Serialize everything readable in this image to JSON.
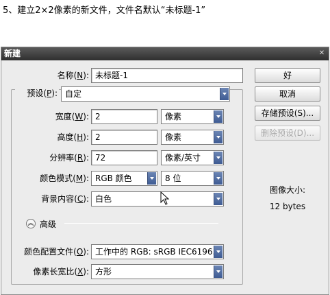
{
  "caption": "5、建立2×2像素的新文件，文件名默认“未标题-1”",
  "dialog": {
    "title": "新建",
    "name": {
      "label": "名称",
      "key": "N",
      "value": "未标题-1"
    },
    "preset": {
      "label": "预设",
      "key": "P",
      "value": "自定"
    },
    "width": {
      "label": "宽度",
      "key": "W",
      "value": "2",
      "unit": "像素"
    },
    "height": {
      "label": "高度",
      "key": "H",
      "value": "2",
      "unit": "像素"
    },
    "resolution": {
      "label": "分辨率",
      "key": "R",
      "value": "72",
      "unit": "像素/英寸"
    },
    "color_mode": {
      "label": "颜色模式",
      "key": "M",
      "value": "RGB 颜色",
      "depth": "8 位"
    },
    "background": {
      "label": "背景内容",
      "key": "C",
      "value": "白色"
    },
    "advanced": {
      "label": "高级"
    },
    "color_profile": {
      "label": "颜色配置文件",
      "key": "O",
      "value": "工作中的 RGB: sRGB IEC6196..."
    },
    "pixel_aspect": {
      "label": "像素长宽比",
      "key": "X",
      "value": "方形"
    },
    "buttons": {
      "ok": "好",
      "cancel": "取消",
      "save_preset": "存储预设(S)...",
      "delete_preset": "删除预设(D)..."
    },
    "image_size": {
      "label": "图像大小:",
      "value": "12 bytes"
    }
  },
  "colors": {
    "accent": "#3e5b93",
    "titlebar": "#3a3a3a"
  }
}
